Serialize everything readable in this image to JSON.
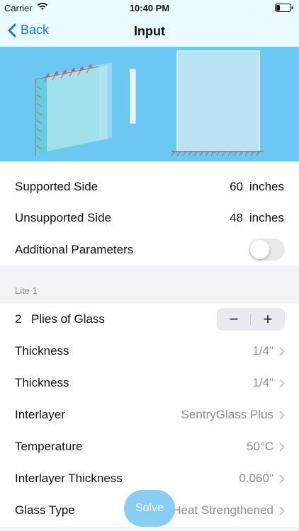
{
  "status": {
    "carrier": "Carrier",
    "time": "10:40 PM"
  },
  "nav": {
    "back_label": "Back",
    "title": "Input"
  },
  "dimensions": {
    "supported_label": "Supported Side",
    "supported_value": "60",
    "supported_unit": "inches",
    "unsupported_label": "Unsupported Side",
    "unsupported_value": "48",
    "unsupported_unit": "inches",
    "additional_label": "Additional Parameters",
    "additional_on": false
  },
  "lite": {
    "header": "Lite 1",
    "plies_count": "2",
    "plies_label": "Plies of Glass",
    "stepper_minus": "−",
    "stepper_plus": "+",
    "rows": [
      {
        "label": "Thickness",
        "value": "1/4\""
      },
      {
        "label": "Thickness",
        "value": "1/4\""
      },
      {
        "label": "Interlayer",
        "value": "SentryGlass Plus"
      },
      {
        "label": "Temperature",
        "value": "50°C"
      },
      {
        "label": "Interlayer Thickness",
        "value": "0.060\""
      },
      {
        "label": "Glass Type",
        "value": "Heat Strengthened"
      }
    ]
  },
  "solve_label": "Solve",
  "colors": {
    "accent": "#1a73e8",
    "banner": "#6cc8f2",
    "solve": "#7ec9f3"
  }
}
